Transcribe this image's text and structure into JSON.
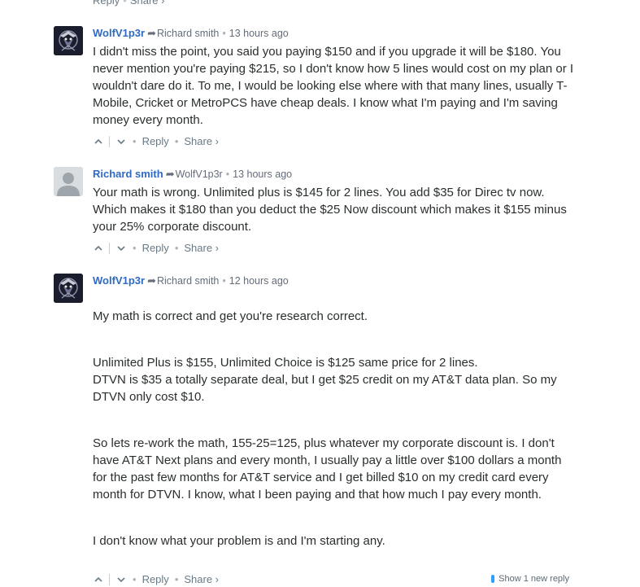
{
  "top": {
    "reply_label": "Reply",
    "share_label": "Share ›"
  },
  "comments": [
    {
      "author": "WolfV1p3r",
      "in_reply_to": "Richard smith",
      "time": "13 hours ago",
      "paragraphs": [
        "I didn't miss the point, you said you paying $150 and if you upgrade it will be $180. You never mention you're paying $215, so I don't know how 5 lines would cost on my plan or I wouldn't dare do it. To me, I would be looking else where with that many lines, usually T-Mobile, Cricket or MetroPCS have cheap deals. I know what I'm paying and I'm saving money every month."
      ],
      "reply_label": "Reply",
      "share_label": "Share ›"
    },
    {
      "author": "Richard smith",
      "in_reply_to": "WolfV1p3r",
      "time": "13 hours ago",
      "paragraphs": [
        "Your math is wrong. Unlimited plus is $145 for 2 lines. You add $35 for Direc tv now. Which makes it $180 than you deduct the $25 Now discount which makes it $155 minus your 25% corporate discount."
      ],
      "reply_label": "Reply",
      "share_label": "Share ›"
    },
    {
      "author": "WolfV1p3r",
      "in_reply_to": "Richard smith",
      "time": "12 hours ago",
      "paragraphs": [
        "My math is correct and get you're research correct.",
        "Unlimited Plus is $155, Unlimited Choice is $125 same price for 2 lines.\nDTVN is $35 a totally separate deal, but I get $25 credit on my AT&T data plan. So my DTVN only cost $10.",
        "So lets re-work the math, 155-25=125, plus whatever my corporate discount is. I don't have AT&T Next plans and every month, I usually pay a little over $100 dollars a month for the past few months for AT&T service and I get billed $10 on my credit card every month for DTVN. I know, what I been paying and that how much I pay every month.",
        "I don't know what your problem is and I'm starting any."
      ],
      "reply_label": "Reply",
      "share_label": "Share ›",
      "new_replies_label": "Show 1 new reply"
    }
  ],
  "colors": {
    "author": "#2e6ac6",
    "meta": "#656c7a",
    "new_reply_bar": "#2e9fff"
  }
}
